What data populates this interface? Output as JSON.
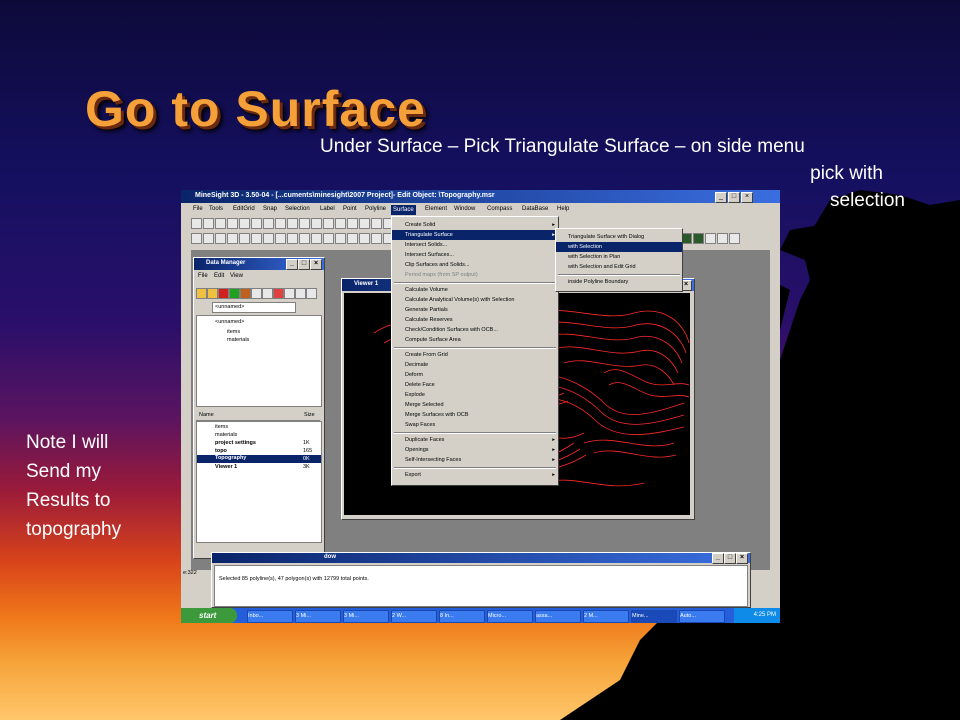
{
  "slide": {
    "title": "Go to Surface",
    "instruction_line1": "Under Surface – Pick Triangulate Surface – on side menu",
    "instruction_line2": "pick with",
    "instruction_line3": "selection",
    "note_lines": [
      "Note I will",
      "Send my",
      "Results to",
      "topography"
    ]
  },
  "app": {
    "window_title": "MineSight 3D  - 3.50-04 - [...cuments\\minesight\\2007 Project]- Edit Object: \\Topography.msr",
    "menus": [
      "File",
      "Tools",
      "EditGrid",
      "Snap",
      "Selection",
      "Label",
      "Point",
      "Polyline",
      "Surface",
      "Element",
      "Window",
      "Compass",
      "DataBase",
      "Help"
    ],
    "selected_menu": "Surface"
  },
  "data_manager": {
    "title": "Data Manager",
    "menus": [
      "File",
      "Edit",
      "View"
    ],
    "dropdown": "<unnamed>",
    "tree": [
      "<unnamed>",
      "items",
      "materials"
    ],
    "columns": [
      "Name",
      "Size"
    ],
    "rows": [
      {
        "name": "items",
        "size": ""
      },
      {
        "name": "materials",
        "size": ""
      },
      {
        "name": "project settings",
        "size": "1K"
      },
      {
        "name": "topo",
        "size": "165"
      },
      {
        "name": "Topography",
        "size": "0K"
      },
      {
        "name": "Viewer 1",
        "size": "3K"
      }
    ]
  },
  "viewer": {
    "title": "Viewer 1"
  },
  "surface_menu": [
    {
      "label": "Create Solid",
      "arrow": true
    },
    {
      "label": "Triangulate Surface",
      "arrow": true,
      "highlight": true
    },
    {
      "label": "Intersect Solids..."
    },
    {
      "label": "Intersect Surfaces..."
    },
    {
      "label": "Clip Surfaces and Solids..."
    },
    {
      "label": "Period maps (from SP output)",
      "disabled": true
    },
    {
      "sep": true
    },
    {
      "label": "Calculate Volume"
    },
    {
      "label": "Calculate Analytical Volume(s) with Selection"
    },
    {
      "label": "Generate Partials"
    },
    {
      "label": "Calculate Reserves"
    },
    {
      "label": "Check/Condition Surfaces with OCB..."
    },
    {
      "label": "Compute Surface Area"
    },
    {
      "sep": true
    },
    {
      "label": "Create From Grid"
    },
    {
      "label": "Decimate"
    },
    {
      "label": "Deform"
    },
    {
      "label": "Delete Face"
    },
    {
      "label": "Explode"
    },
    {
      "label": "Merge Selected"
    },
    {
      "label": "Merge Surfaces with OCB"
    },
    {
      "label": "Swap Faces"
    },
    {
      "sep": true
    },
    {
      "label": "Duplicate Faces",
      "arrow": true
    },
    {
      "label": "Openings",
      "arrow": true
    },
    {
      "label": "Self-Intersecting Faces",
      "arrow": true
    },
    {
      "sep": true
    },
    {
      "label": "Export",
      "arrow": true
    }
  ],
  "triangulate_submenu": [
    {
      "label": "Triangulate Surface with Dialog"
    },
    {
      "label": "with Selection",
      "highlight": true
    },
    {
      "label": "with Selection in Plan"
    },
    {
      "label": "with Selection and Edit Grid"
    },
    {
      "sep": true
    },
    {
      "label": "inside Polyline Boundary"
    }
  ],
  "message": {
    "window_label": "dow",
    "text": "Selected 85 polyline(s), 47 polygon(s) with 12799 total points.",
    "status": "e:322"
  },
  "taskbar": {
    "start": "start",
    "items": [
      "Inbo...",
      "3 Mi...",
      "3 Mi...",
      "2 W...",
      "8 In...",
      "Micro...",
      "assa...",
      "2 M...",
      "Mine...",
      "Auto..."
    ],
    "time": "4:25 PM"
  },
  "colors": {
    "title": "#f5a038",
    "contour": "#ff2a2a",
    "xp_blue": "#245edb"
  }
}
